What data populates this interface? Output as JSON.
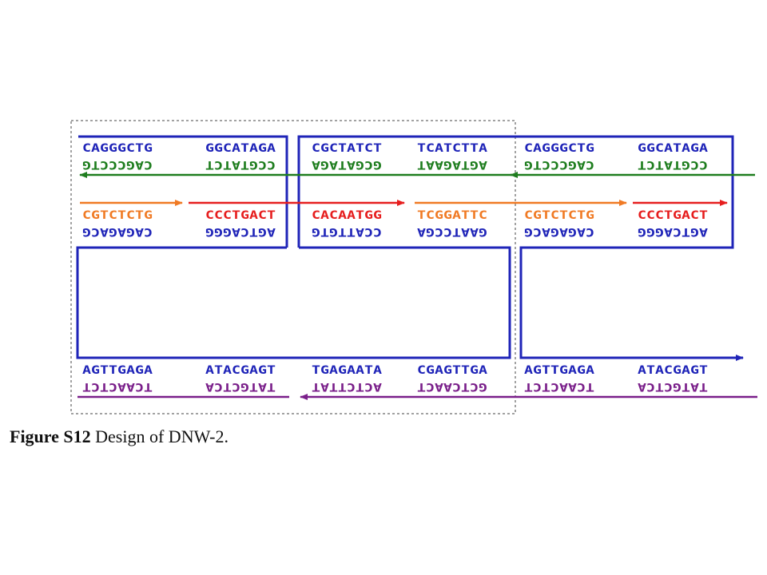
{
  "colors": {
    "blue": "#1f24b8",
    "green": "#1e7d1e",
    "orange": "#f07a24",
    "red": "#e61e1e",
    "purple": "#7a1f8a",
    "frame": "#444444"
  },
  "rows": {
    "top_upper": [
      "CAGGGCTG",
      "GGCATAGA",
      "CGCTATCT",
      "TCATCTTA",
      "CAGGGCTG",
      "GGCATAGA"
    ],
    "top_lower": [
      "CAGCCCTG",
      "CCGTATCT",
      "GCGATAGA",
      "AGTAGAAT",
      "CAGCCCTG",
      "CCGTATCT"
    ],
    "mid_upper": [
      "CGTCTCTG",
      "CCCTGACT",
      "CACAATGG",
      "TCGGATTC",
      "CGTCTCTG",
      "CCCTGACT"
    ],
    "mid_lower": [
      "CAGAGACG",
      "AGTCAGGG",
      "CCATTGTG",
      "GAATCCGA",
      "CAGAGACG",
      "AGTCAGGG"
    ],
    "bot_upper": [
      "AGTTGAGA",
      "ATACGAGT",
      "TGAGAATA",
      "CGAGTTGA",
      "AGTTGAGA",
      "ATACGAGT"
    ],
    "bot_lower": [
      "TCAACTCT",
      "TATGCTCA",
      "ACTCTTAT",
      "GCTCAACT",
      "TCAACTCT",
      "TATGCTCA"
    ]
  },
  "caption": {
    "label": "Figure S12",
    "text": " Design of DNW-2."
  }
}
